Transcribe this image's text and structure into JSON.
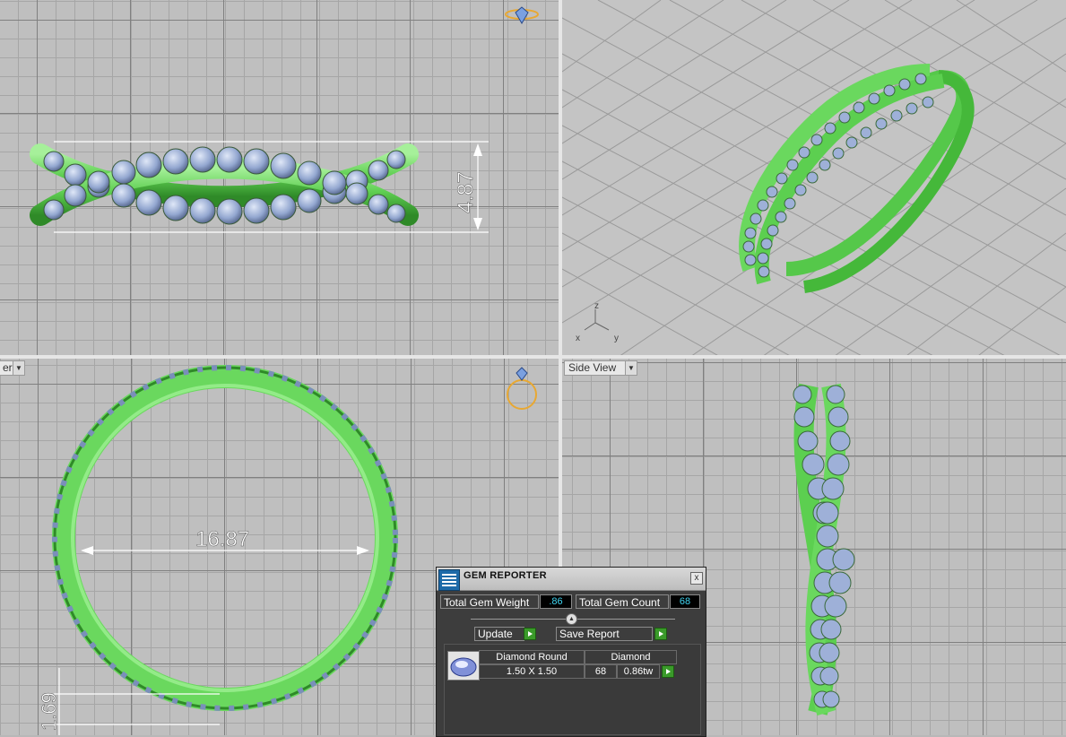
{
  "viewports": {
    "top_right_axes": {
      "x": "x",
      "y": "y",
      "z": "z"
    },
    "bottom_left_label": "er",
    "bottom_right_label": "Side View"
  },
  "dimensions": {
    "height": "4.87",
    "diameter": "16.87",
    "band_width": "1.69"
  },
  "gem_reporter": {
    "title": "GEM REPORTER",
    "close_glyph": "x",
    "total_gem_weight_label": "Total Gem Weight",
    "total_gem_weight_value": ".86",
    "total_gem_count_label": "Total Gem Count",
    "total_gem_count_value": "68",
    "update_label": "Update",
    "save_report_label": "Save Report",
    "row": {
      "shape": "Diamond Round",
      "material": "Diamond",
      "size": "1.50 X 1.50",
      "count": "68",
      "weight": "0.86tw"
    }
  },
  "colors": {
    "band": "#7be070",
    "gem": "#9eb0d8",
    "accent_cyan": "#3fd4f0",
    "go_green": "#3a9a2a"
  }
}
